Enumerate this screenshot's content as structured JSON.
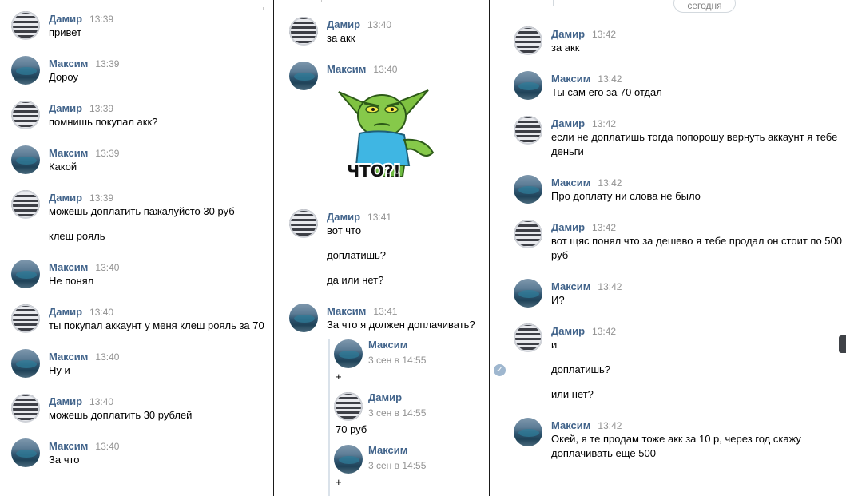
{
  "panels": [
    {
      "messages": [
        {
          "author": "Дамир",
          "time": "13:39",
          "lines": [
            "привет"
          ]
        },
        {
          "author": "Максим",
          "time": "13:39",
          "lines": [
            "Дороу"
          ]
        },
        {
          "author": "Дамир",
          "time": "13:39",
          "lines": [
            "помнишь покупал акк?"
          ]
        },
        {
          "author": "Максим",
          "time": "13:39",
          "lines": [
            "Какой"
          ]
        },
        {
          "author": "Дамир",
          "time": "13:39",
          "lines": [
            "можешь доплатить пажалуйсто 30 руб",
            "клеш рояль"
          ]
        },
        {
          "author": "Максим",
          "time": "13:40",
          "lines": [
            "Не понял"
          ]
        },
        {
          "author": "Дамир",
          "time": "13:40",
          "lines": [
            "ты покупал аккаунт у меня клеш рояль за 70"
          ]
        },
        {
          "author": "Максим",
          "time": "13:40",
          "lines": [
            "Ну и"
          ]
        },
        {
          "author": "Дамир",
          "time": "13:40",
          "lines": [
            "можешь доплатить 30 рублей"
          ]
        },
        {
          "author": "Максим",
          "time": "13:40",
          "lines": [
            "За что"
          ]
        }
      ]
    },
    {
      "messages": [
        {
          "author": "Дамир",
          "time": "13:40",
          "lines": [
            "за акк"
          ]
        },
        {
          "author": "Максим",
          "time": "13:40",
          "lines": [],
          "sticker_text": "ЧТО?!"
        },
        {
          "author": "Дамир",
          "time": "13:41",
          "lines": [
            "вот что",
            "доплатишь?",
            "да или нет?"
          ]
        },
        {
          "author": "Максим",
          "time": "13:41",
          "lines": [
            "За что я должен доплачивать?"
          ]
        }
      ],
      "forwarded": [
        {
          "author": "Максим",
          "date": "3 сен в 14:55",
          "text": "+"
        },
        {
          "author": "Дамир",
          "date": "3 сен в 14:55",
          "text": "70 руб"
        },
        {
          "author": "Максим",
          "date": "3 сен в 14:55",
          "text": "+"
        }
      ]
    },
    {
      "date_label": "сегодня",
      "messages": [
        {
          "author": "Дамир",
          "time": "13:42",
          "lines": [
            "за акк"
          ]
        },
        {
          "author": "Максим",
          "time": "13:42",
          "lines": [
            "Ты сам его за 70 отдал"
          ]
        },
        {
          "author": "Дамир",
          "time": "13:42",
          "lines": [
            "если не доплатишь тогда попорошу вернуть аккаунт я тебе",
            "деньги"
          ]
        },
        {
          "author": "Максим",
          "time": "13:42",
          "lines": [
            "Про доплату ни слова не было"
          ]
        },
        {
          "author": "Дамир",
          "time": "13:42",
          "lines": [
            "вот щяс понял что за дешево я тебе продал он стоит по 500",
            "руб"
          ]
        },
        {
          "author": "Максим",
          "time": "13:42",
          "lines": [
            "И?"
          ]
        },
        {
          "author": "Дамир",
          "time": "13:42",
          "lines": [
            "и",
            "доплатишь?",
            "или нет?"
          ]
        },
        {
          "author": "Максим",
          "time": "13:42",
          "lines": [
            "Окей, я те продам тоже акк за 10 р, через год скажу",
            "доплачивать ещё 500"
          ]
        }
      ]
    }
  ]
}
